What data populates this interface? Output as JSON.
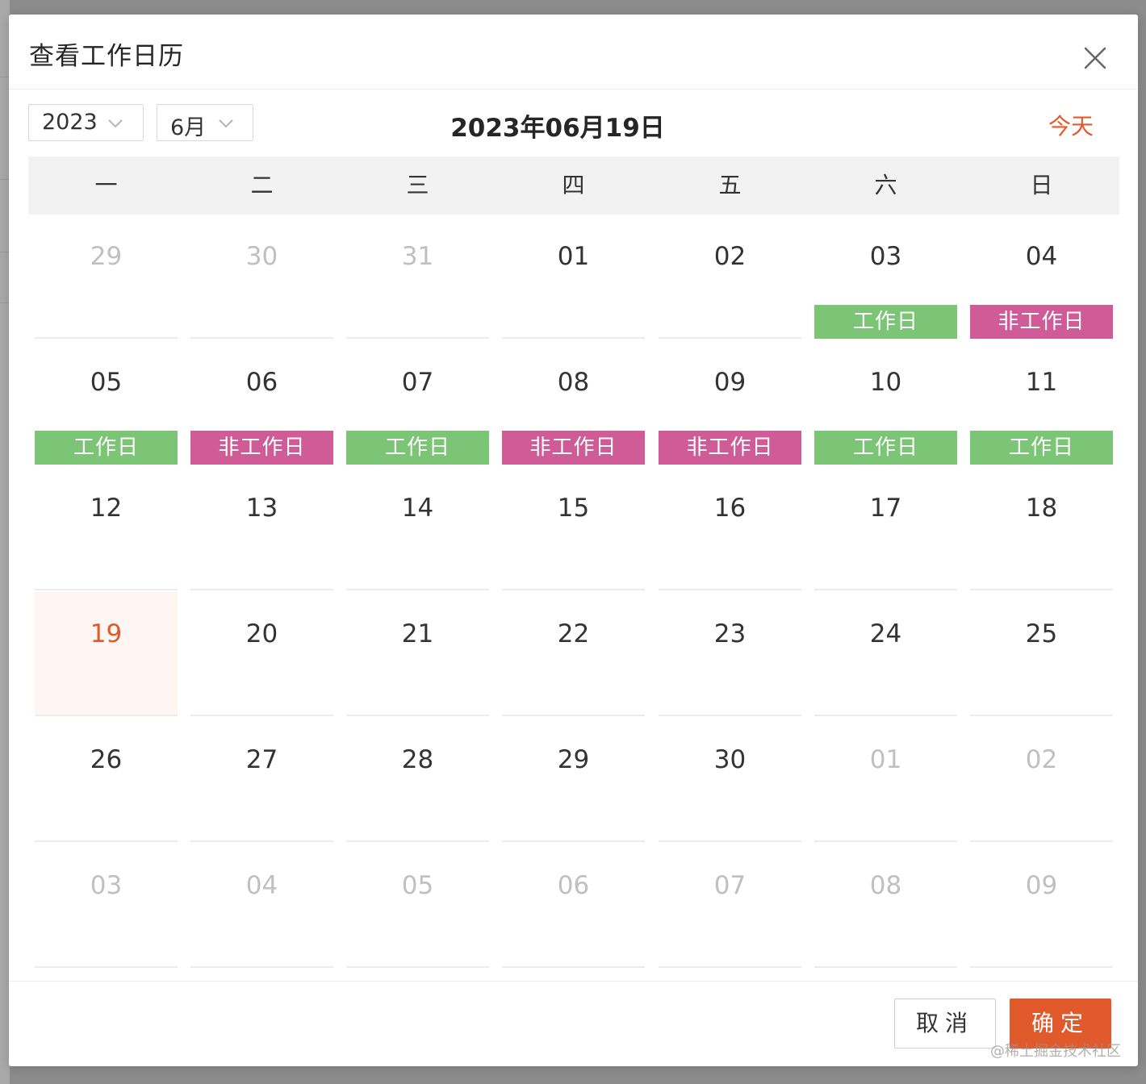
{
  "modal": {
    "title": "查看工作日历"
  },
  "toolbar": {
    "year_value": "2023",
    "month_value": "6月",
    "current_date": "2023年06月19日",
    "today_label": "今天"
  },
  "weekdays": [
    "一",
    "二",
    "三",
    "四",
    "五",
    "六",
    "日"
  ],
  "tags": {
    "work": "工作日",
    "off": "非工作日"
  },
  "colors": {
    "accent": "#e05a2b",
    "work_tag": "#7cc576",
    "off_tag": "#d05c97",
    "today_bg": "#fff5f2",
    "muted_text": "#c0c0c0"
  },
  "calendar": {
    "weeks": [
      [
        {
          "day": "29",
          "other": true
        },
        {
          "day": "30",
          "other": true
        },
        {
          "day": "31",
          "other": true
        },
        {
          "day": "01"
        },
        {
          "day": "02"
        },
        {
          "day": "03",
          "tag": "work"
        },
        {
          "day": "04",
          "tag": "off"
        }
      ],
      [
        {
          "day": "05",
          "tag": "work"
        },
        {
          "day": "06",
          "tag": "off"
        },
        {
          "day": "07",
          "tag": "work"
        },
        {
          "day": "08",
          "tag": "off"
        },
        {
          "day": "09",
          "tag": "off"
        },
        {
          "day": "10",
          "tag": "work"
        },
        {
          "day": "11",
          "tag": "work"
        }
      ],
      [
        {
          "day": "12"
        },
        {
          "day": "13"
        },
        {
          "day": "14"
        },
        {
          "day": "15"
        },
        {
          "day": "16"
        },
        {
          "day": "17"
        },
        {
          "day": "18"
        }
      ],
      [
        {
          "day": "19",
          "today": true
        },
        {
          "day": "20"
        },
        {
          "day": "21"
        },
        {
          "day": "22"
        },
        {
          "day": "23"
        },
        {
          "day": "24"
        },
        {
          "day": "25"
        }
      ],
      [
        {
          "day": "26"
        },
        {
          "day": "27"
        },
        {
          "day": "28"
        },
        {
          "day": "29"
        },
        {
          "day": "30"
        },
        {
          "day": "01",
          "other": true
        },
        {
          "day": "02",
          "other": true
        }
      ],
      [
        {
          "day": "03",
          "other": true
        },
        {
          "day": "04",
          "other": true
        },
        {
          "day": "05",
          "other": true
        },
        {
          "day": "06",
          "other": true
        },
        {
          "day": "07",
          "other": true
        },
        {
          "day": "08",
          "other": true
        },
        {
          "day": "09",
          "other": true
        }
      ]
    ]
  },
  "footer": {
    "cancel_label": "取消",
    "ok_label": "确定"
  },
  "watermark": "@稀土掘金技术社区"
}
